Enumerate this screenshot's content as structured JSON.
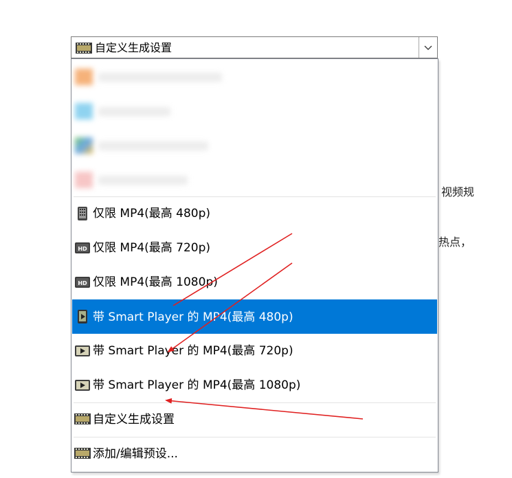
{
  "combo": {
    "selected_label": "自定义生成设置",
    "icon": "film-strip-icon"
  },
  "dropdown": {
    "items": [
      {
        "label": "仅限 MP4(最高 480p)",
        "icon": "mobile-device-icon"
      },
      {
        "label": "仅限 MP4(最高 720p)",
        "icon": "hd-badge-icon"
      },
      {
        "label": "仅限 MP4(最高 1080p)",
        "icon": "hd-badge-icon"
      },
      {
        "label": "带 Smart Player 的 MP4(最高 480p)",
        "icon": "mobile-player-icon"
      },
      {
        "label": "带 Smart Player 的 MP4(最高 720p)",
        "icon": "play-icon"
      },
      {
        "label": "带 Smart Player 的 MP4(最高 1080p)",
        "icon": "play-icon"
      },
      {
        "label": "自定义生成设置",
        "icon": "film-strip-icon"
      },
      {
        "label": "添加/编辑预设...",
        "icon": "film-strip-icon"
      }
    ]
  },
  "background": {
    "fragment_1": "视频规",
    "fragment_2": "热点，"
  },
  "colors": {
    "selection": "#0078d7",
    "annotation_arrow": "#e02020"
  }
}
